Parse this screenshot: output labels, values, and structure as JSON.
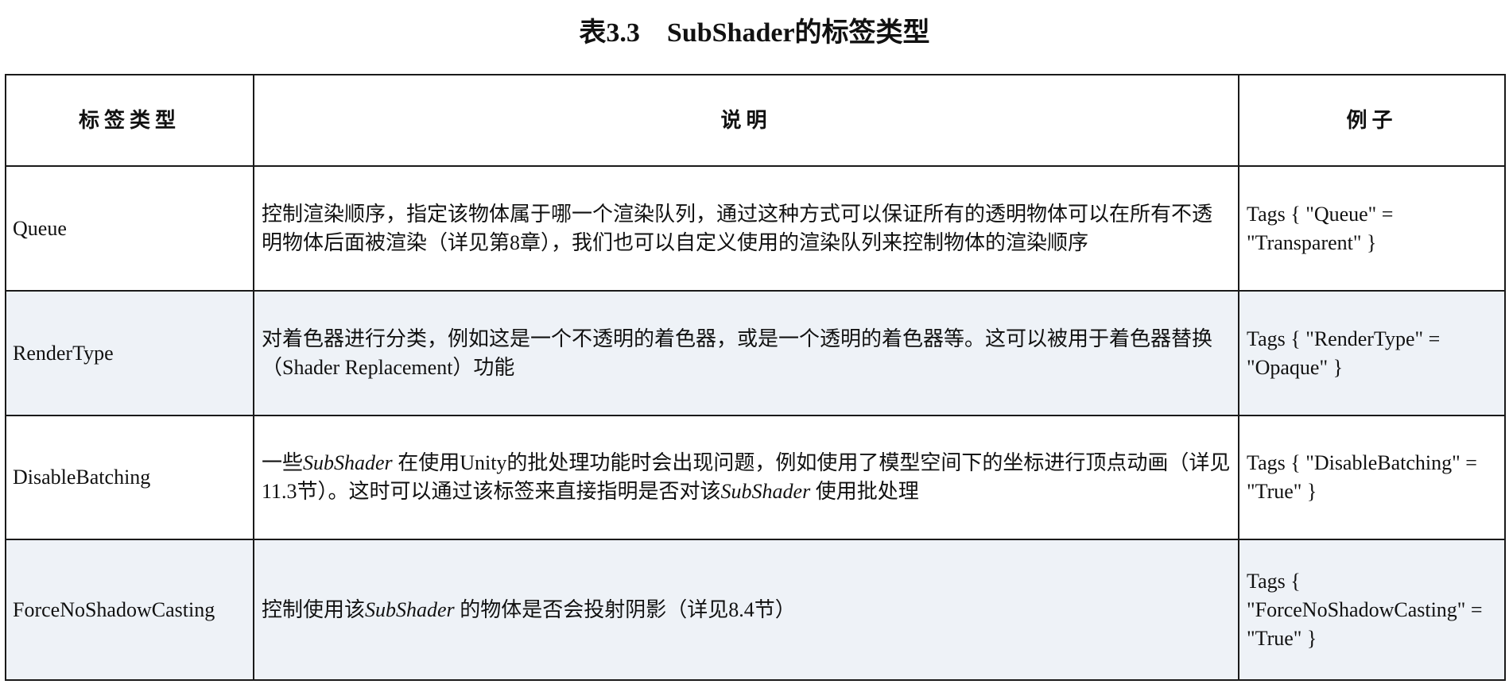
{
  "caption": "表3.3　SubShader的标签类型",
  "table": {
    "headers": [
      "标签类型",
      "说明",
      "例子"
    ],
    "rows": [
      {
        "name": "Queue",
        "desc_parts": [
          "控制渲染顺序，指定该物体属于哪一个渲染队列，通过这种方式可以保证所有的透明物体可以在所有不透明物体后面被渲染（详见第8章），我们也可以自定义使用的渲染队列来控制物体的渲染顺序"
        ],
        "example": "Tags { \"Queue\" = \"Transparent\" }"
      },
      {
        "name": "RenderType",
        "desc_parts": [
          "对着色器进行分类，例如这是一个不透明的着色器，或是一个透明的着色器等。这可以被用于着色器替换（Shader Replacement）功能"
        ],
        "example": "Tags { \"RenderType\" = \"Opaque\" }"
      },
      {
        "name": "DisableBatching",
        "desc_parts": [
          "一些",
          "SubShader",
          " 在使用Unity的批处理功能时会出现问题，例如使用了模型空间下的坐标进行顶点动画（详见11.3节）。这时可以通过该标签来直接指明是否对该",
          "SubShader",
          " 使用批处理"
        ],
        "example": "Tags { \"DisableBatching\" = \"True\" }"
      },
      {
        "name": "ForceNoShadowCasting",
        "desc_parts": [
          "控制使用该",
          "SubShader",
          " 的物体是否会投射阴影（详见8.4节）"
        ],
        "example": "Tags { \"ForceNoShadowCasting\" = \"True\" }"
      }
    ]
  }
}
